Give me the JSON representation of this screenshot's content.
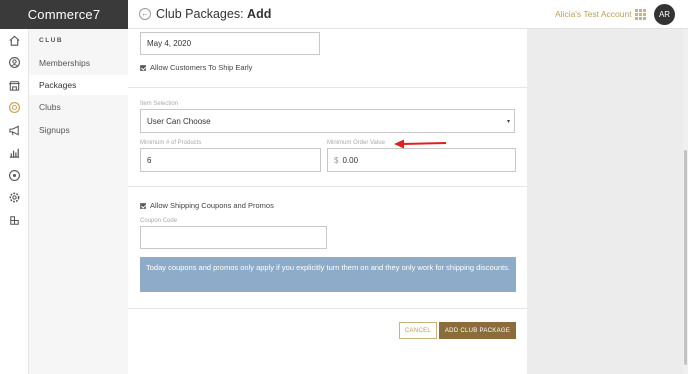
{
  "brand": {
    "name": "Commerce7"
  },
  "header": {
    "back_glyph": "←",
    "title_prefix": "Club Packages:",
    "title_action": "Add",
    "account_name": "Alicia's Test Account",
    "avatar_initials": "AR"
  },
  "rail_icons": [
    "home-icon",
    "customers-icon",
    "store-icon",
    "clubs-icon",
    "megaphone-icon",
    "reports-icon",
    "palette-icon",
    "settings-icon",
    "apps-icon"
  ],
  "submenu": {
    "title": "CLUB",
    "items": [
      {
        "label": "Memberships",
        "active": false
      },
      {
        "label": "Packages",
        "active": true
      },
      {
        "label": "Clubs",
        "active": false
      },
      {
        "label": "Signups",
        "active": false
      }
    ]
  },
  "form": {
    "date_value": "May 4, 2020",
    "ship_early_label": "Allow Customers To Ship Early",
    "ship_early_checked": true,
    "item_selection_label": "Item Selection",
    "item_selection_value": "User Can Choose",
    "item_selection_caret": "▾",
    "min_products_label": "Minimum # of Products",
    "min_products_value": "6",
    "min_order_label": "Minimum Order Value",
    "min_order_prefix": "$",
    "min_order_value": "0.00",
    "shipping_coupons_label": "Allow Shipping Coupons and Promos",
    "shipping_coupons_checked": true,
    "coupon_code_label": "Coupon Code",
    "coupon_code_value": "",
    "info_text": "Today coupons and promos only apply if you explicitly turn them on and they only work for shipping discounts."
  },
  "actions": {
    "cancel_label": "CANCEL",
    "add_label": "ADD CLUB PACKAGE"
  },
  "colors": {
    "brand_bg": "#3a3a3a",
    "gold": "#b9a05a",
    "primary_button": "#8a6d3b",
    "info_bg": "#8eacc8",
    "annotation_arrow": "#e02020"
  }
}
